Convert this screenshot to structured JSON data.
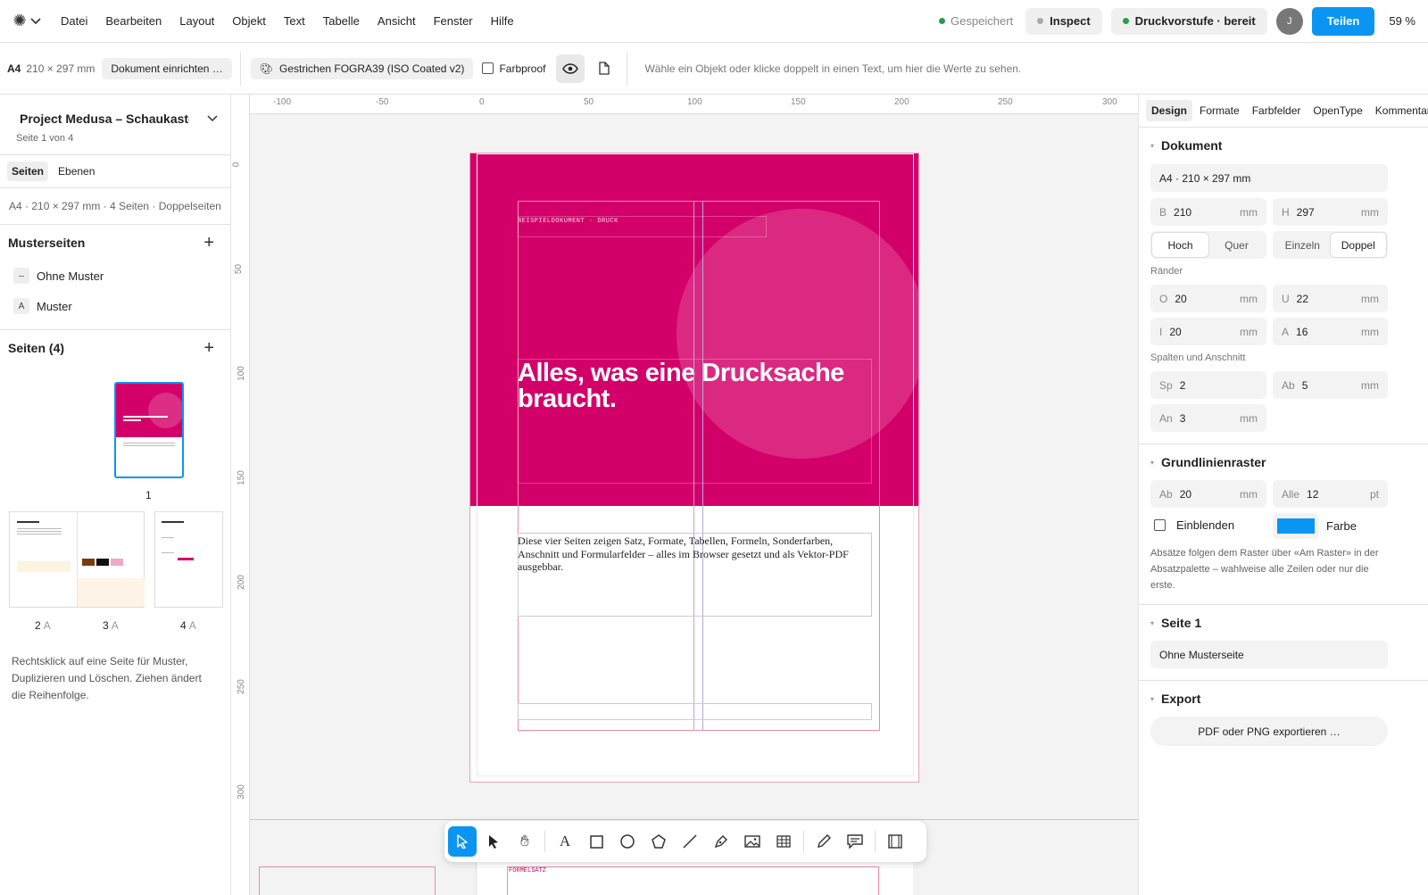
{
  "menu": [
    "Datei",
    "Bearbeiten",
    "Layout",
    "Objekt",
    "Text",
    "Tabelle",
    "Ansicht",
    "Fenster",
    "Hilfe"
  ],
  "status": {
    "saved": "Gespeichert",
    "inspect": "Inspect",
    "prepress": "Druckvorstufe · bereit",
    "avatar": "J",
    "share": "Teilen",
    "zoom": "59 %"
  },
  "colors": {
    "accent": "#0a95f2",
    "brand": "#d4006a",
    "saved_dot": "#2a9d4a",
    "inspect_dot": "#aaaaaa",
    "prepress_dot": "#2a9d4a"
  },
  "toolbar": {
    "format": "A4",
    "dims": "210 × 297 mm",
    "setup": "Dokument einrichten …",
    "profile": "Gestrichen FOGRA39 (ISO Coated v2)",
    "proof": "Farbproof",
    "hint": "Wähle ein Objekt oder klicke doppelt in einen Text, um hier die Werte zu sehen."
  },
  "left": {
    "project": "Project Medusa – Schaukasten",
    "page_of": "Seite 1 von 4",
    "tabs": [
      "Seiten",
      "Ebenen"
    ],
    "doc_info": "A4 · 210 × 297 mm · 4 Seiten · Doppelseiten",
    "masters_title": "Musterseiten",
    "masters": [
      {
        "badge": "–",
        "name": "Ohne Muster"
      },
      {
        "badge": "A",
        "name": "Muster"
      }
    ],
    "pages_title": "Seiten (4)",
    "page_labels": [
      {
        "num": "1",
        "master": ""
      },
      {
        "num": "2",
        "master": "A"
      },
      {
        "num": "3",
        "master": "A"
      },
      {
        "num": "4",
        "master": "A"
      }
    ],
    "hint": "Rechtsklick auf eine Seite für Muster, Duplizieren und Löschen. Ziehen ändert die Reihenfolge."
  },
  "rulers": {
    "top": [
      "-100",
      "-50",
      "0",
      "50",
      "100",
      "150",
      "200",
      "250",
      "300"
    ],
    "left": [
      "0",
      "50",
      "100",
      "150",
      "200",
      "250",
      "300"
    ]
  },
  "page": {
    "eyebrow": "BEISPIELDOKUMENT · DRUCK",
    "headline": "Alles, was eine Drucksache braucht.",
    "body": "Diese vier Seiten zeigen Satz, Formate, Tabellen, Formeln, Sonderfarben, Anschnitt und Formularfelder – alles im Browser gesetzt und als Vektor-PDF ausgebbar.",
    "next_label": "FORMELSATZ"
  },
  "tools": [
    "select-arrow",
    "direct-select",
    "hand",
    "text",
    "rectangle",
    "ellipse",
    "polygon",
    "line",
    "pen",
    "image",
    "table",
    "pencil",
    "comment",
    "frame"
  ],
  "right": {
    "tabs": [
      "Design",
      "Formate",
      "Farbfelder",
      "OpenType",
      "Kommentare"
    ],
    "doc_title": "Dokument",
    "doc_format": "A4 · 210 × 297 mm",
    "width": {
      "k": "B",
      "v": "210",
      "u": "mm"
    },
    "height": {
      "k": "H",
      "v": "297",
      "u": "mm"
    },
    "orientation": [
      "Hoch",
      "Quer"
    ],
    "pages_mode": [
      "Einzeln",
      "Doppel"
    ],
    "margins_label": "Ränder",
    "m_top": {
      "k": "O",
      "v": "20",
      "u": "mm"
    },
    "m_bottom": {
      "k": "U",
      "v": "22",
      "u": "mm"
    },
    "m_inner": {
      "k": "I",
      "v": "20",
      "u": "mm"
    },
    "m_outer": {
      "k": "A",
      "v": "16",
      "u": "mm"
    },
    "cols_label": "Spalten und Anschnitt",
    "cols": {
      "k": "Sp",
      "v": "2",
      "u": ""
    },
    "gap": {
      "k": "Ab",
      "v": "5",
      "u": "mm"
    },
    "bleed": {
      "k": "An",
      "v": "3",
      "u": "mm"
    },
    "grid_title": "Grundlinienraster",
    "grid_start": {
      "k": "Ab",
      "v": "20",
      "u": "mm"
    },
    "grid_every": {
      "k": "Alle",
      "v": "12",
      "u": "pt"
    },
    "show_grid": "Einblenden",
    "grid_color_label": "Farbe",
    "grid_color": "#0a95f2",
    "grid_note": "Absätze folgen dem Raster über «Am Raster» in der Absatzpalette – wahlweise alle Zeilen oder nur die erste.",
    "page_title": "Seite 1",
    "page_master": "Ohne Musterseite",
    "export_title": "Export",
    "export_btn": "PDF oder PNG exportieren …"
  }
}
